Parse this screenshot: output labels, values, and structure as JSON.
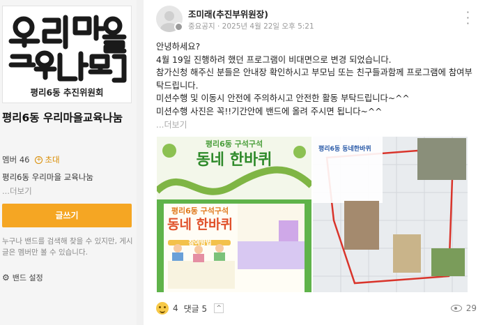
{
  "sidebar": {
    "cover_caption": "평리6동 추진위원회",
    "logo_text": "우리마을 교육나눔",
    "band_name": "평리6동 우리마을교육나눔",
    "member_label": "멤버 46",
    "invite_label": "초대",
    "description": "평리6동 우리마을 교육나눔",
    "more_label": "...더보기",
    "write_button": "글쓰기",
    "search_note": "누구나 밴드를 검색해 찾을 수 있지만, 게시글은 멤버만 볼 수 있습니다.",
    "settings_label": "밴드 설정"
  },
  "post": {
    "author": "조미래(추진부위원장)",
    "tag": "중요공지",
    "date": "2025년 4월 22일 오후 5:21",
    "lines": [
      "안녕하세요?",
      "4월 19일 진행하려 했던 프로그램이 비대면으로 변경 되었습니다.",
      "참가신청 해주신 분들은 안내장 확인하시고 부모님 또는 친구들과함께 프로그램에 참여부탁드립니다.",
      "미션수행 및 이동시 안전에 주의하시고 안전한 활동 부탁드립니다~^^",
      "미션수행 사진은 꼭!!기간안에 밴드에 올려 주시면 됩니다~^^"
    ],
    "more_label": "...더보기",
    "image1": {
      "top_title": "평리6동 구석구석",
      "top_big": "동네 한바퀴",
      "poster_title": "평리6동 구석구석",
      "poster_big": "동네 한바퀴",
      "poster_sub": "참여방법"
    },
    "image2": {
      "map_title": "평리6동 동네한바퀴"
    },
    "reactions": "4",
    "comments_label": "댓글 5",
    "views": "29"
  }
}
